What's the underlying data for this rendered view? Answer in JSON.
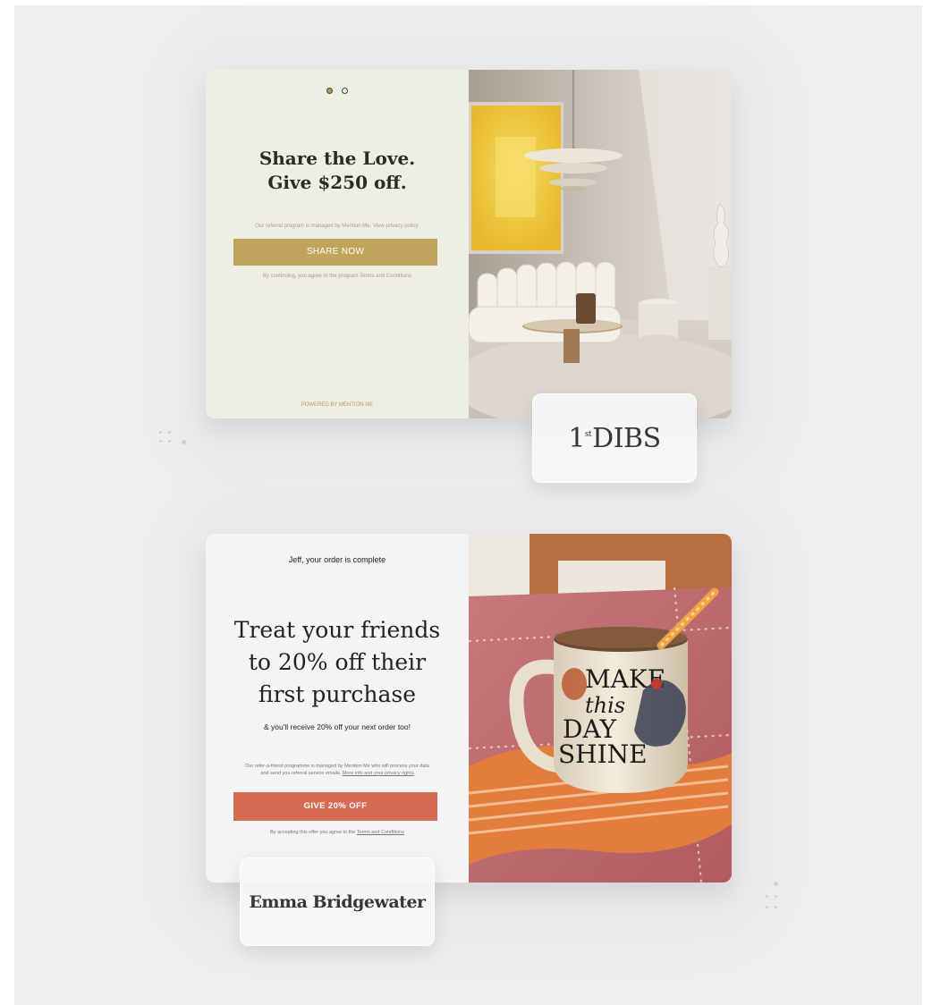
{
  "card1": {
    "headline_line1": "Share the Love.",
    "headline_line2": "Give $250 off.",
    "note": "Our referral program is managed by Mention Me. View privacy policy.",
    "cta_label": "SHARE NOW",
    "terms": "By continuing, you agree to the program Terms and Conditions",
    "powered_by": "POWERED BY MENTION ME",
    "carousel": {
      "count": 2,
      "active": 1
    },
    "brand": {
      "logo_main": "DIBS",
      "logo_prefix": "1",
      "logo_sup": "st"
    },
    "accent_color": "#c1a45b"
  },
  "card2": {
    "order_status": "Jeff, your order is complete",
    "headline_line1": "Treat your friends",
    "headline_line2": "to 20% off their",
    "headline_line3": "first purchase",
    "subheadline": "& you'll receive 20% off your next order too!",
    "note": "Our refer-a-friend programme is managed by Mention Me who will process your data and send you referral service emails.",
    "note_link": "More info and your privacy rights",
    "cta_label": "GIVE 20% OFF",
    "terms_prefix": "By accepting this offer you agree to the",
    "terms_link": "Terms and Conditions",
    "mug_text": [
      "MAKE",
      "this",
      "DAY",
      "SHINE"
    ],
    "brand": {
      "logo": "Emma Bridgewater"
    },
    "accent_color": "#d46b55"
  }
}
